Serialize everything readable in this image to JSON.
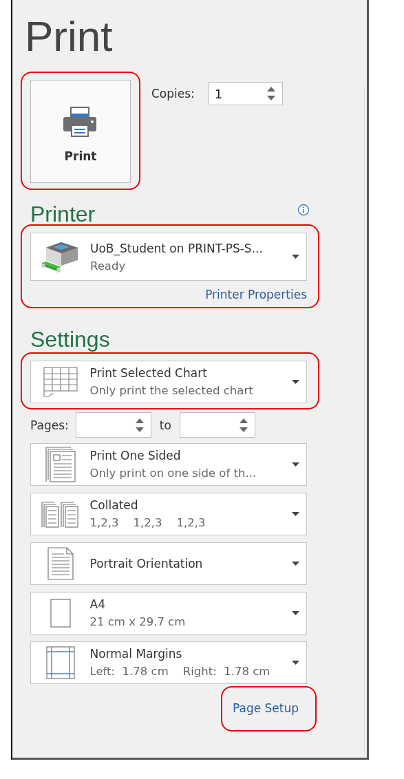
{
  "title": "Print",
  "print_button": {
    "label": "Print",
    "highlighted": true
  },
  "copies": {
    "label": "Copies:",
    "value": "1"
  },
  "printer": {
    "heading": "Printer",
    "name": "UoB_Student on PRINT-PS-S...",
    "status": "Ready",
    "highlighted": true,
    "properties_link": "Printer Properties"
  },
  "settings": {
    "heading": "Settings",
    "what": {
      "kind": "grid",
      "title": "Print Selected Chart",
      "subtitle": "Only print the selected chart",
      "highlighted": true
    },
    "pages": {
      "label": "Pages:",
      "to_label": "to"
    },
    "options": [
      {
        "kind": "sided",
        "title": "Print One Sided",
        "subtitle": "Only print on one side of th...",
        "highlighted": false
      },
      {
        "kind": "collate",
        "title": "Collated",
        "subtitle": "1,2,3    1,2,3    1,2,3",
        "highlighted": false
      },
      {
        "kind": "portrait",
        "title": "Portrait Orientation",
        "highlighted": false
      },
      {
        "kind": "paper",
        "title": "A4",
        "subtitle": "21 cm x 29.7 cm",
        "highlighted": false
      },
      {
        "kind": "margins",
        "title": "Normal Margins",
        "subtitle": "Left:  1.78 cm    Right:  1.78 cm",
        "highlighted": false
      }
    ]
  },
  "page_setup": {
    "label": "Page Setup",
    "highlighted": true
  }
}
